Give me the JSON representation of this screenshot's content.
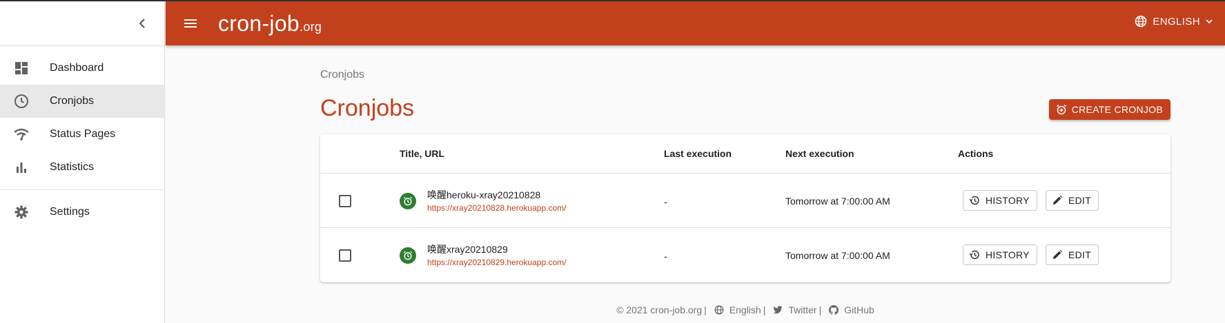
{
  "header": {
    "logo_main": "cron-job",
    "logo_suffix": ".org",
    "language": "ENGLISH",
    "brand_color": "#c2411c"
  },
  "sidebar": {
    "items": [
      {
        "label": "Dashboard",
        "icon": "dashboard-icon"
      },
      {
        "label": "Cronjobs",
        "icon": "clock-icon",
        "active": true
      },
      {
        "label": "Status Pages",
        "icon": "wifi-signal-icon"
      },
      {
        "label": "Statistics",
        "icon": "bar-chart-icon"
      }
    ],
    "settings": {
      "label": "Settings",
      "icon": "gear-icon"
    }
  },
  "main": {
    "breadcrumb": "Cronjobs",
    "title": "Cronjobs",
    "create_label": "CREATE CRONJOB",
    "columns": {
      "title_url": "Title, URL",
      "last_execution": "Last execution",
      "next_execution": "Next execution",
      "actions": "Actions"
    },
    "rows": [
      {
        "title": "唤醒heroku-xray20210828",
        "url": "https://xray20210828.herokuapp.com/",
        "last_execution": "-",
        "next_execution": "Tomorrow at 7:00:00 AM",
        "history_label": "HISTORY",
        "edit_label": "EDIT"
      },
      {
        "title": "唤醒xray20210829",
        "url": "https://xray20210829.herokuapp.com/",
        "last_execution": "-",
        "next_execution": "Tomorrow at 7:00:00 AM",
        "history_label": "HISTORY",
        "edit_label": "EDIT"
      }
    ]
  },
  "footer": {
    "copyright": "© 2021 cron-job.org",
    "language": "English",
    "twitter": "Twitter",
    "github": "GitHub",
    "separator": "|"
  }
}
